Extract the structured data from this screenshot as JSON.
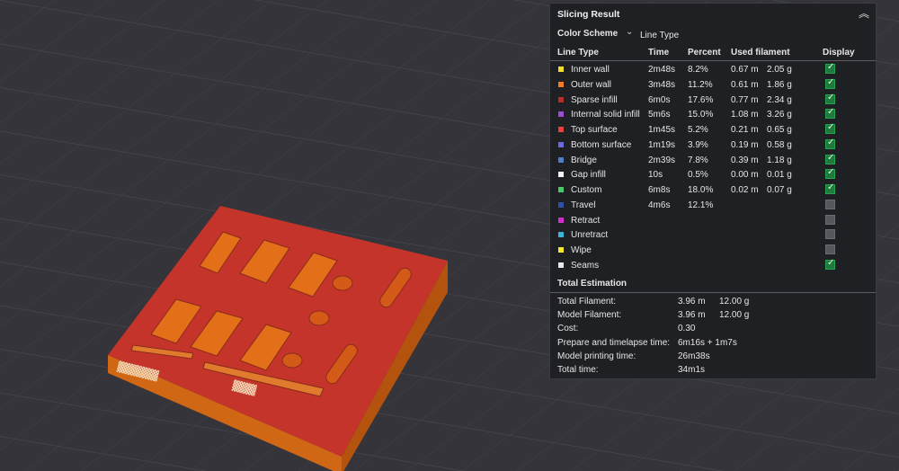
{
  "panel": {
    "title": "Slicing Result",
    "color_scheme_label": "Color Scheme",
    "color_scheme_value": "Line Type",
    "headers": {
      "type": "Line Type",
      "time": "Time",
      "percent": "Percent",
      "filament": "Used filament",
      "display": "Display"
    },
    "rows": [
      {
        "name": "Inner wall",
        "color": "#f2dc2c",
        "time": "2m48s",
        "pct": "8.2%",
        "m": "0.67 m",
        "g": "2.05 g",
        "on": true
      },
      {
        "name": "Outer wall",
        "color": "#f07c2a",
        "time": "3m48s",
        "pct": "11.2%",
        "m": "0.61 m",
        "g": "1.86 g",
        "on": true
      },
      {
        "name": "Sparse infill",
        "color": "#b52e27",
        "time": "6m0s",
        "pct": "17.6%",
        "m": "0.77 m",
        "g": "2.34 g",
        "on": true
      },
      {
        "name": "Internal solid infill",
        "color": "#9b4ed0",
        "time": "5m6s",
        "pct": "15.0%",
        "m": "1.08 m",
        "g": "3.26 g",
        "on": true
      },
      {
        "name": "Top surface",
        "color": "#e8403a",
        "time": "1m45s",
        "pct": "5.2%",
        "m": "0.21 m",
        "g": "0.65 g",
        "on": true
      },
      {
        "name": "Bottom surface",
        "color": "#6a6ae0",
        "time": "1m19s",
        "pct": "3.9%",
        "m": "0.19 m",
        "g": "0.58 g",
        "on": true
      },
      {
        "name": "Bridge",
        "color": "#4f7fc4",
        "time": "2m39s",
        "pct": "7.8%",
        "m": "0.39 m",
        "g": "1.18 g",
        "on": true
      },
      {
        "name": "Gap infill",
        "color": "#f4f4f4",
        "time": "10s",
        "pct": "0.5%",
        "m": "0.00 m",
        "g": "0.01 g",
        "on": true
      },
      {
        "name": "Custom",
        "color": "#4cc86a",
        "time": "6m8s",
        "pct": "18.0%",
        "m": "0.02 m",
        "g": "0.07 g",
        "on": true
      },
      {
        "name": "Travel",
        "color": "#2e4fae",
        "time": "4m6s",
        "pct": "12.1%",
        "m": "",
        "g": "",
        "on": false
      },
      {
        "name": "Retract",
        "color": "#cc2fcc",
        "time": "",
        "pct": "",
        "m": "",
        "g": "",
        "on": false
      },
      {
        "name": "Unretract",
        "color": "#3fb4d8",
        "time": "",
        "pct": "",
        "m": "",
        "g": "",
        "on": false
      },
      {
        "name": "Wipe",
        "color": "#f6e92a",
        "time": "",
        "pct": "",
        "m": "",
        "g": "",
        "on": false
      },
      {
        "name": "Seams",
        "color": "#e9e9e9",
        "time": "",
        "pct": "",
        "m": "",
        "g": "",
        "on": true
      }
    ],
    "total_title": "Total Estimation",
    "estimates": [
      {
        "k": "Total Filament:",
        "v1": "3.96 m",
        "v2": "12.00 g"
      },
      {
        "k": "Model Filament:",
        "v1": "3.96 m",
        "v2": "12.00 g"
      },
      {
        "k": "Cost:",
        "v1": "0.30",
        "v2": ""
      },
      {
        "k": "Prepare and timelapse time:",
        "v1": "6m16s + 1m7s",
        "v2": ""
      },
      {
        "k": "Model printing time:",
        "v1": "26m38s",
        "v2": ""
      },
      {
        "k": "Total time:",
        "v1": "34m1s",
        "v2": ""
      }
    ]
  },
  "colors": {
    "model_top": "#c4342a",
    "model_side": "#cf6714",
    "bed": "#34343a",
    "panel_bg": "#1f2023",
    "check_on": "#1f7a3e"
  },
  "icons": {
    "collapse": "chevron-up-double-icon",
    "dropdown": "chevron-down-icon"
  }
}
